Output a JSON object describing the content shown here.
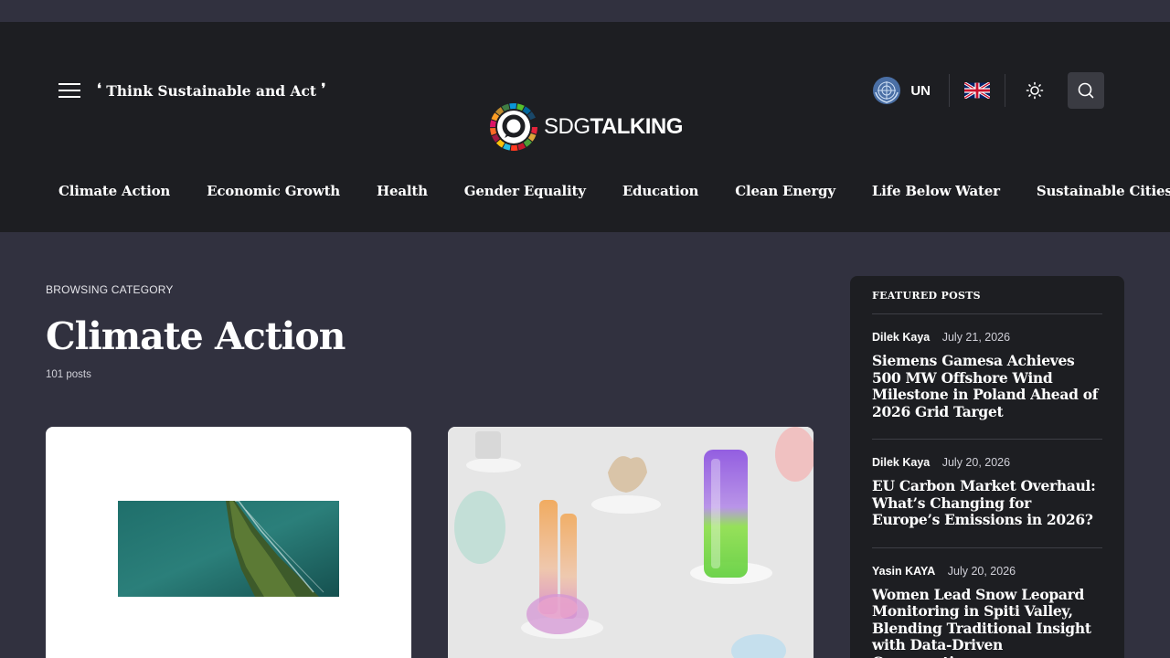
{
  "header": {
    "tagline": "Think Sustainable and Act",
    "logo": {
      "sdg": "SDG",
      "talking": "TALKING"
    },
    "un_label": "UN"
  },
  "nav": [
    "Climate Action",
    "Economic Growth",
    "Health",
    "Gender Equality",
    "Education",
    "Clean Energy",
    "Life Below Water",
    "Sustainable Cities"
  ],
  "category": {
    "browsing_label": "BROWSING CATEGORY",
    "title": "Climate Action",
    "post_count": "101 posts"
  },
  "sidebar": {
    "title": "FEATURED POSTS",
    "posts": [
      {
        "author": "Dilek Kaya",
        "date": "July 21, 2026",
        "title": "Siemens Gamesa Achieves 500 MW Offshore Wind Milestone in Poland Ahead of 2026 Grid Target"
      },
      {
        "author": "Dilek Kaya",
        "date": "July 20, 2026",
        "title": "EU Carbon Market Overhaul: What’s Changing for Europe’s Emissions in 2026?"
      },
      {
        "author": "Yasin KAYA",
        "date": "July 20, 2026",
        "title": "Women Lead Snow Leopard Monitoring in Spiti Valley, Blending Traditional Insight with Data-Driven Conservation"
      }
    ]
  },
  "icons": {
    "menu": "hamburger-icon",
    "un": "un-emblem-icon",
    "flag": "uk-flag-icon",
    "theme": "sun-icon",
    "search": "search-icon"
  },
  "colors": {
    "page_bg": "#31313f",
    "header_bg": "#1d1e22",
    "card_bg": "#1d1e22"
  }
}
